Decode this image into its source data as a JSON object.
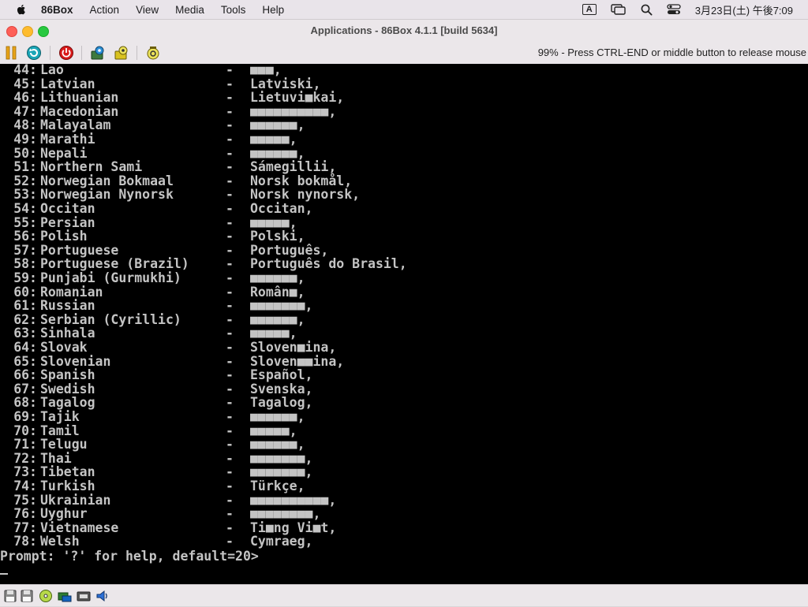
{
  "menubar": {
    "app_name": "86Box",
    "menus": [
      "Action",
      "View",
      "Media",
      "Tools",
      "Help"
    ],
    "input_badge": "A",
    "clock": "3月23日(土) 午後7:09"
  },
  "window": {
    "title": "Applications - 86Box 4.1.1 [build 5634]"
  },
  "toolbar": {
    "status_message": "99% - Press CTRL-END or middle button to release mouse",
    "icons": [
      "pause-icon",
      "reset-icon",
      "power-icon",
      "settings-icon",
      "ctrl-alt-del-icon",
      "screenshot-icon"
    ]
  },
  "screen": {
    "languages": [
      {
        "num": "44:",
        "name": "Lao",
        "native": "■■■,"
      },
      {
        "num": "45:",
        "name": "Latvian",
        "native": "Latviski,"
      },
      {
        "num": "46:",
        "name": "Lithuanian",
        "native": "Lietuvi■kai,"
      },
      {
        "num": "47:",
        "name": "Macedonian",
        "native": "■■■■■■■■■■,"
      },
      {
        "num": "48:",
        "name": "Malayalam",
        "native": "■■■■■■,"
      },
      {
        "num": "49:",
        "name": "Marathi",
        "native": "■■■■■,"
      },
      {
        "num": "50:",
        "name": "Nepali",
        "native": "■■■■■■,"
      },
      {
        "num": "51:",
        "name": "Northern Sami",
        "native": "Sámegillii,"
      },
      {
        "num": "52:",
        "name": "Norwegian Bokmaal",
        "native": "Norsk bokmål,"
      },
      {
        "num": "53:",
        "name": "Norwegian Nynorsk",
        "native": "Norsk nynorsk,"
      },
      {
        "num": "54:",
        "name": "Occitan",
        "native": "Occitan,"
      },
      {
        "num": "55:",
        "name": "Persian",
        "native": "■■■■■,"
      },
      {
        "num": "56:",
        "name": "Polish",
        "native": "Polski,"
      },
      {
        "num": "57:",
        "name": "Portuguese",
        "native": "Português,"
      },
      {
        "num": "58:",
        "name": "Portuguese (Brazil)",
        "native": "Português do Brasil,"
      },
      {
        "num": "59:",
        "name": "Punjabi (Gurmukhi)",
        "native": "■■■■■■,"
      },
      {
        "num": "60:",
        "name": "Romanian",
        "native": "Român■,"
      },
      {
        "num": "61:",
        "name": "Russian",
        "native": "■■■■■■■,"
      },
      {
        "num": "62:",
        "name": "Serbian (Cyrillic)",
        "native": "■■■■■■,"
      },
      {
        "num": "63:",
        "name": "Sinhala",
        "native": "■■■■■,"
      },
      {
        "num": "64:",
        "name": "Slovak",
        "native": "Sloven■ina,"
      },
      {
        "num": "65:",
        "name": "Slovenian",
        "native": "Sloven■■ina,"
      },
      {
        "num": "66:",
        "name": "Spanish",
        "native": "Español,"
      },
      {
        "num": "67:",
        "name": "Swedish",
        "native": "Svenska,"
      },
      {
        "num": "68:",
        "name": "Tagalog",
        "native": "Tagalog,"
      },
      {
        "num": "69:",
        "name": "Tajik",
        "native": "■■■■■■,"
      },
      {
        "num": "70:",
        "name": "Tamil",
        "native": "■■■■■,"
      },
      {
        "num": "71:",
        "name": "Telugu",
        "native": "■■■■■■,"
      },
      {
        "num": "72:",
        "name": "Thai",
        "native": "■■■■■■■,"
      },
      {
        "num": "73:",
        "name": "Tibetan",
        "native": "■■■■■■■,"
      },
      {
        "num": "74:",
        "name": "Turkish",
        "native": "Türkçe,"
      },
      {
        "num": "75:",
        "name": "Ukrainian",
        "native": "■■■■■■■■■■,"
      },
      {
        "num": "76:",
        "name": "Uyghur",
        "native": "■■■■■■■■,"
      },
      {
        "num": "77:",
        "name": "Vietnamese",
        "native": "Ti■ng Vi■t,"
      },
      {
        "num": "78:",
        "name": "Welsh",
        "native": "Cymraeg,"
      }
    ],
    "separator": "-",
    "prompt": "Prompt: '?' for help, default=20>",
    "cursor": "_"
  },
  "statusbar": {
    "icons": [
      "floppy-1-icon",
      "floppy-2-icon",
      "cdrom-icon",
      "hard-disk-icon",
      "network-icon",
      "sound-icon"
    ]
  }
}
